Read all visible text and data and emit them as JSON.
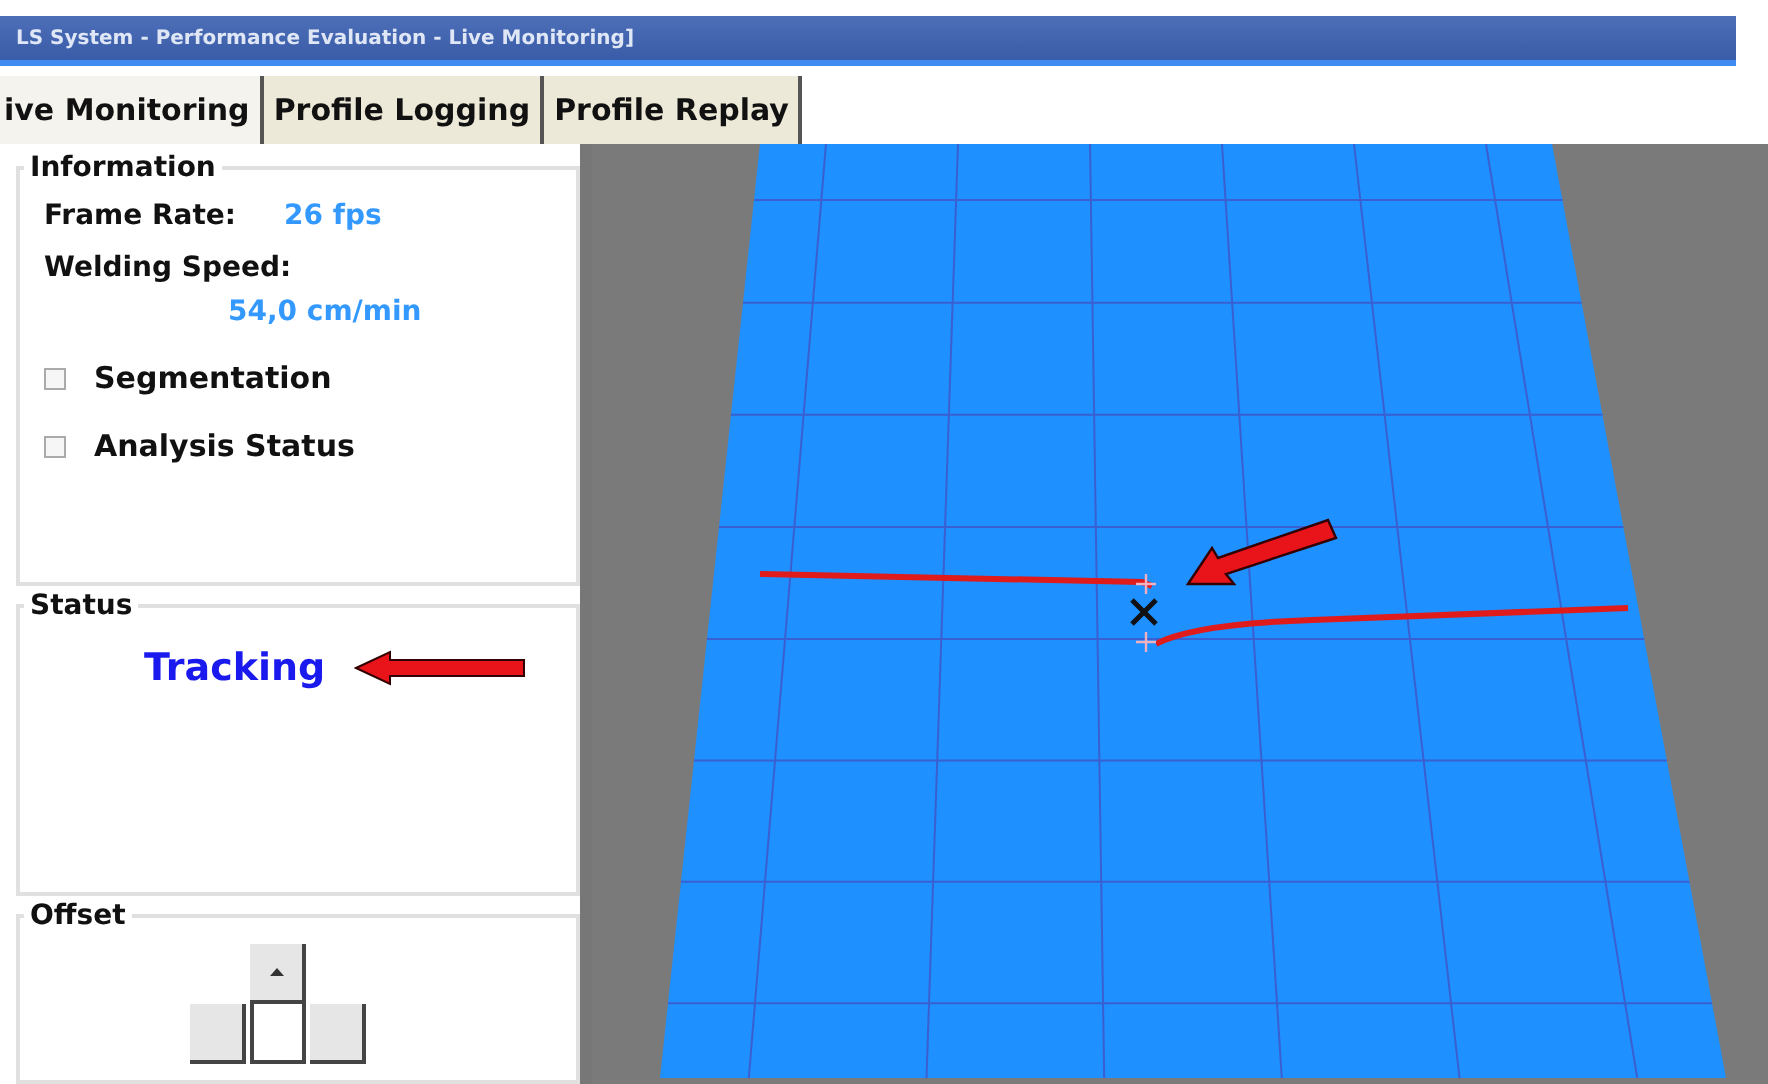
{
  "window": {
    "title": "LS System - Performance Evaluation - Live Monitoring]"
  },
  "tabs": [
    {
      "label": "ive Monitoring",
      "selected": true
    },
    {
      "label": "Profile Logging",
      "selected": false
    },
    {
      "label": "Profile Replay",
      "selected": false
    }
  ],
  "information": {
    "title": "Information",
    "fields": [
      {
        "label": "Frame Rate:",
        "value": "26 fps",
        "kind": "inline"
      },
      {
        "label": "Welding Speed:",
        "value": "54,0 cm/min",
        "kind": "below"
      }
    ],
    "options": [
      {
        "label": "Segmentation",
        "checked": false
      },
      {
        "label": "Analysis Status",
        "checked": false
      }
    ]
  },
  "status": {
    "title": "Status",
    "value": "Tracking"
  },
  "offset": {
    "title": "Offset"
  }
}
